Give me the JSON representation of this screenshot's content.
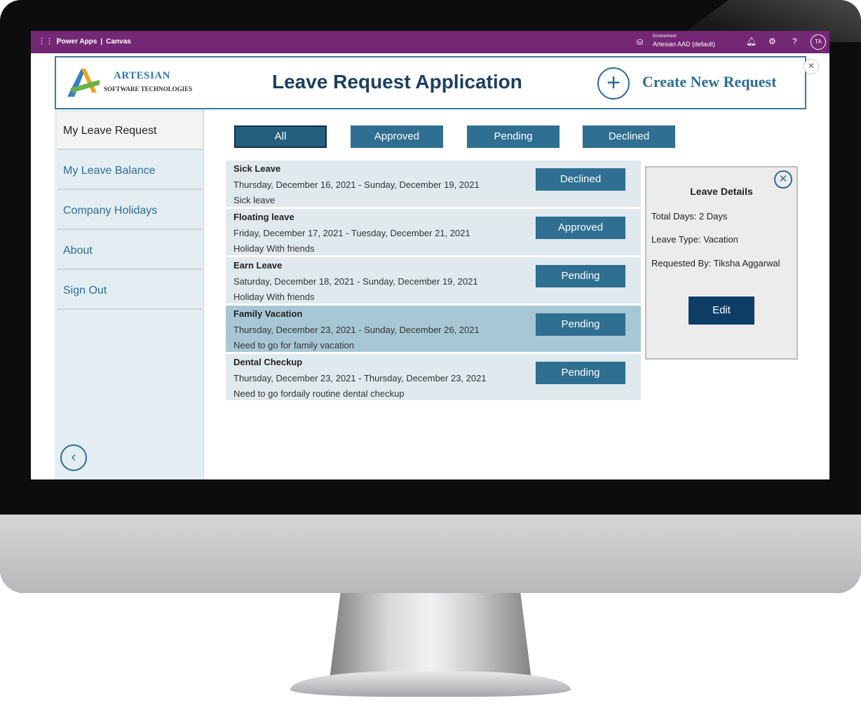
{
  "topbar": {
    "product": "Power Apps",
    "separator": "|",
    "app_type": "Canvas",
    "environment_label": "Environment",
    "environment_value": "Artesian AAD (default)",
    "avatar_initials": "TA",
    "help_glyph": "?"
  },
  "header": {
    "logo_title": "ARTESIAN",
    "logo_subtitle": "SOFTWARE TECHNOLOGIES",
    "app_title": "Leave Request Application",
    "create_label": "Create New Request"
  },
  "sidebar": {
    "items": [
      {
        "label": "My Leave Request"
      },
      {
        "label": "My Leave Balance"
      },
      {
        "label": "Company Holidays"
      },
      {
        "label": "About"
      },
      {
        "label": "Sign Out"
      }
    ]
  },
  "filters": [
    {
      "label": "All"
    },
    {
      "label": "Approved"
    },
    {
      "label": "Pending"
    },
    {
      "label": "Declined"
    }
  ],
  "requests": [
    {
      "title": "Sick Leave",
      "dates": "Thursday, December 16, 2021 - Sunday, December 19, 2021",
      "note": "Sick leave",
      "status": "Declined"
    },
    {
      "title": "Floating leave",
      "dates": "Friday, December 17, 2021 - Tuesday, December 21, 2021",
      "note": "Holiday With friends",
      "status": "Approved"
    },
    {
      "title": "Earn Leave",
      "dates": "Saturday, December 18, 2021 - Sunday, December 19, 2021",
      "note": "Holiday With friends",
      "status": "Pending"
    },
    {
      "title": "Family Vacation",
      "dates": "Thursday, December 23, 2021 - Sunday, December 26, 2021",
      "note": "Need to go for family vacation",
      "status": "Pending"
    },
    {
      "title": "Dental Checkup",
      "dates": "Thursday, December 23, 2021 - Thursday, December 23, 2021",
      "note": "Need to go fordaily routine dental checkup",
      "status": "Pending"
    }
  ],
  "details": {
    "title": "Leave Details",
    "total_days": "Total Days: 2 Days",
    "leave_type": "Leave Type: Vacation",
    "requested_by": "Requested By: Tiksha Aggarwal",
    "edit_label": "Edit"
  },
  "colors": {
    "topbar": "#742774",
    "accent": "#2f6f91",
    "edit_button": "#0e3d66",
    "title": "#1c3f5e"
  }
}
